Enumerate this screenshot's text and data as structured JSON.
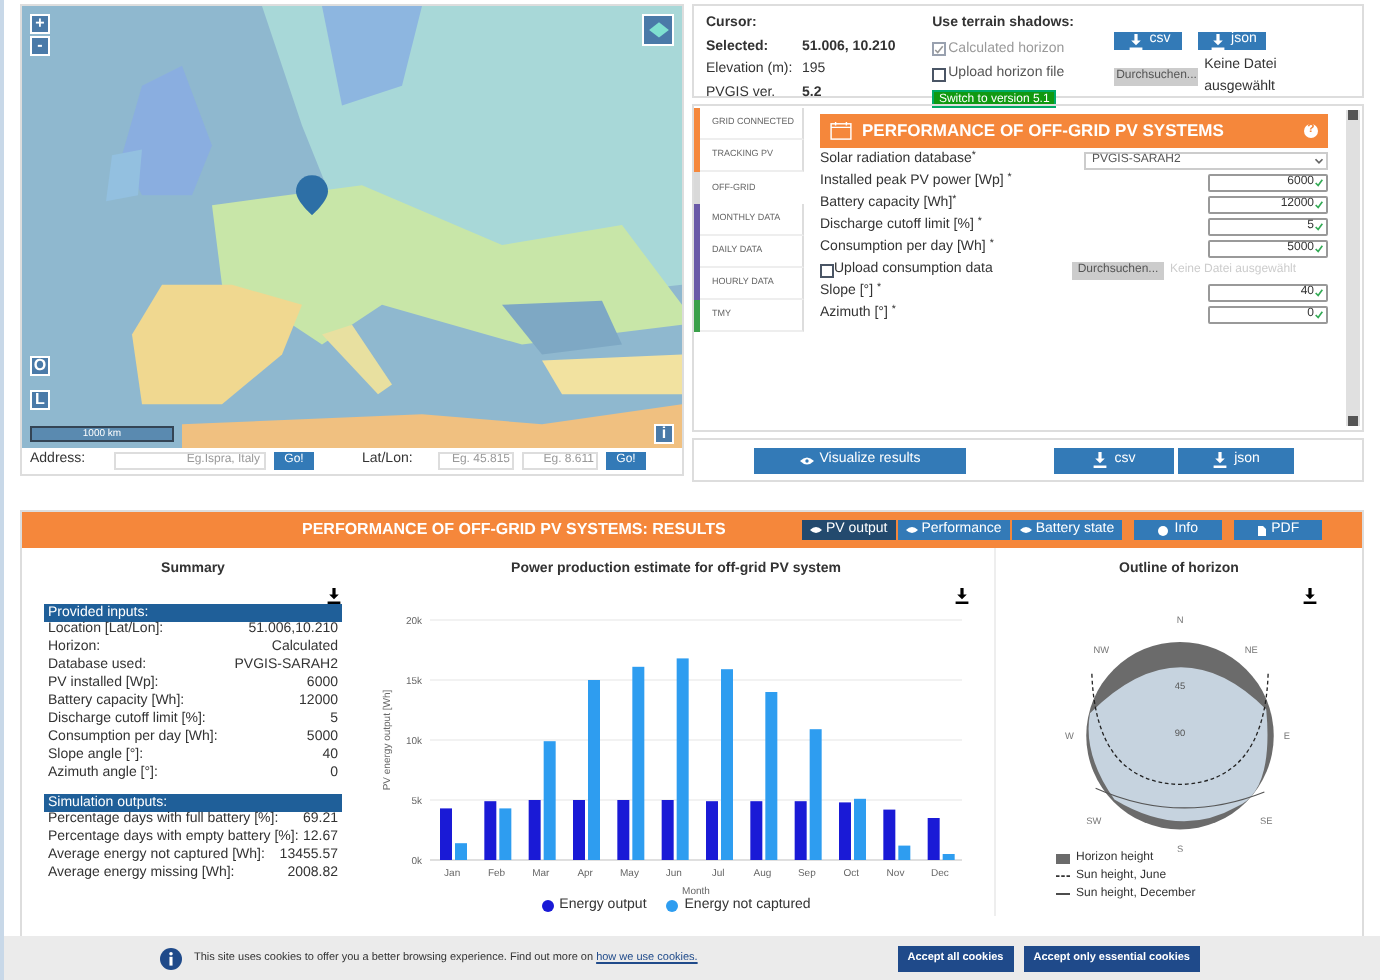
{
  "map": {
    "zoom_in": "+",
    "zoom_out": "-",
    "button_o": "O",
    "button_l": "L",
    "info": "i",
    "scale": "1000 km",
    "address_label": "Address:",
    "address_placeholder": "Eg.Ispra, Italy",
    "go": "Go!",
    "latlon_label": "Lat/Lon:",
    "lat_placeholder": "Eg. 45.815",
    "lon_placeholder": "Eg. 8.611",
    "go2": "Go!"
  },
  "info": {
    "cursor": "Cursor:",
    "selected_label": "Selected:",
    "selected_value": "51.006, 10.210",
    "elevation_label": "Elevation (m):",
    "elevation_value": "195",
    "version_label": "PVGIS ver.",
    "version_value": "5.2",
    "shadows_title": "Use terrain shadows:",
    "calc_horizon": {
      "label": "Calculated horizon",
      "checked": true,
      "disabled": true
    },
    "upload_horizon": {
      "label": "Upload horizon file",
      "checked": false,
      "disabled": false
    },
    "switch": "Switch to version 5.1",
    "csv": "csv",
    "json": "json",
    "browse": "Durchsuchen...",
    "no_file": "Keine Datei ausgewählt"
  },
  "tabs": [
    {
      "label": "GRID CONNECTED",
      "color": "#f5873b",
      "selected": false
    },
    {
      "label": "TRACKING PV",
      "color": "#f5873b",
      "selected": false
    },
    {
      "label": "OFF-GRID",
      "color": "#d9d9d9",
      "selected": true
    },
    {
      "label": "MONTHLY DATA",
      "color": "#6a5aa8",
      "selected": false
    },
    {
      "label": "DAILY DATA",
      "color": "#6a5aa8",
      "selected": false
    },
    {
      "label": "HOURLY DATA",
      "color": "#6a5aa8",
      "selected": false
    },
    {
      "label": "TMY",
      "color": "#3aa04a",
      "selected": false
    }
  ],
  "form": {
    "title": "PERFORMANCE OF OFF-GRID PV SYSTEMS",
    "help": "?",
    "fields": [
      {
        "kind": "select",
        "label": "Solar radiation database$^{*}$",
        "value": "PVGIS-SARAH2"
      },
      {
        "kind": "input",
        "label": "Installed peak PV power [Wp] $^{*}$",
        "value": "6000"
      },
      {
        "kind": "input",
        "label": "Battery capacity [Wh]$^{*}$",
        "value": "12000"
      },
      {
        "kind": "input",
        "label": "Discharge cutoff limit [%] $^{*}$",
        "value": "5"
      },
      {
        "kind": "input",
        "label": "Consumption per day [Wh] $^{*}$",
        "value": "5000"
      },
      {
        "kind": "file",
        "label": "Upload consumption data",
        "checked": false,
        "button": "Durchsuchen...",
        "no_file": "Keine Datei ausgewählt"
      },
      {
        "kind": "input",
        "label": "Slope [°] $^{*}$",
        "value": "40"
      },
      {
        "kind": "input",
        "label": "Azimuth [°] $^{*}$",
        "value": "0"
      }
    ]
  },
  "actions": {
    "visualize": "Visualize results",
    "csv": "csv",
    "json": "json"
  },
  "results": {
    "title": "PERFORMANCE OF OFF-GRID PV SYSTEMS: RESULTS",
    "views": [
      {
        "label": "PV output",
        "selected": true
      },
      {
        "label": "Performance",
        "selected": false
      },
      {
        "label": "Battery state",
        "selected": false
      }
    ],
    "info": "Info",
    "pdf": "PDF"
  },
  "summary": {
    "title": "Summary",
    "inputs_header": "Provided inputs:",
    "inputs": [
      [
        "Location [Lat/Lon]:",
        "51.006,10.210"
      ],
      [
        "Horizon:",
        "Calculated"
      ],
      [
        "Database used:",
        "PVGIS-SARAH2"
      ],
      [
        "PV installed [Wp]:",
        "6000"
      ],
      [
        "Battery capacity [Wh]:",
        "12000"
      ],
      [
        "Discharge cutoff limit [%]:",
        "5"
      ],
      [
        "Consumption per day [Wh]:",
        "5000"
      ],
      [
        "Slope angle [°]:",
        "40"
      ],
      [
        "Azimuth angle [°]:",
        "0"
      ]
    ],
    "outputs_header": "Simulation outputs:",
    "outputs": [
      [
        "Percentage days with full battery [%]:",
        "69.21"
      ],
      [
        "Percentage days with empty battery [%]:",
        "12.67"
      ],
      [
        "Average energy not captured [Wh]:",
        "13455.57"
      ],
      [
        "Average energy missing [Wh]:",
        "2008.82"
      ]
    ]
  },
  "chart_data": {
    "type": "bar",
    "title": "Power production estimate for off-grid PV system",
    "xlabel": "Month",
    "ylabel": "PV energy output [Wh]",
    "categories": [
      "Jan",
      "Feb",
      "Mar",
      "Apr",
      "May",
      "Jun",
      "Jul",
      "Aug",
      "Sep",
      "Oct",
      "Nov",
      "Dec"
    ],
    "series": [
      {
        "name": "Energy output",
        "color": "#1a1ad6",
        "values": [
          4300,
          4900,
          5000,
          5000,
          5000,
          5000,
          4900,
          4900,
          4900,
          4800,
          4200,
          3500
        ]
      },
      {
        "name": "Energy not captured",
        "color": "#2e9df0",
        "values": [
          1400,
          4300,
          9900,
          15000,
          16100,
          16800,
          15900,
          14000,
          10900,
          5100,
          1200,
          500
        ]
      }
    ],
    "ylim": [
      0,
      20000
    ],
    "grid": true,
    "yticks": [
      {
        "value": 0,
        "label": "0k"
      },
      {
        "value": 5000,
        "label": "5k"
      },
      {
        "value": 10000,
        "label": "10k"
      },
      {
        "value": 15000,
        "label": "15k"
      },
      {
        "value": 20000,
        "label": "20k"
      }
    ]
  },
  "horizon": {
    "title": "Outline of horizon",
    "directions": [
      "N",
      "NE",
      "E",
      "SE",
      "S",
      "SW",
      "W",
      "NW"
    ],
    "rings": [
      "45",
      "90"
    ],
    "legend": [
      "Horizon height",
      "Sun height, June",
      "Sun height, December"
    ]
  },
  "cookie": {
    "text": "This site uses cookies to offer you a better browsing experience. Find out more on",
    "link": "how we use cookies.",
    "accept_all": "Accept all cookies",
    "accept_essential": "Accept only essential cookies"
  }
}
